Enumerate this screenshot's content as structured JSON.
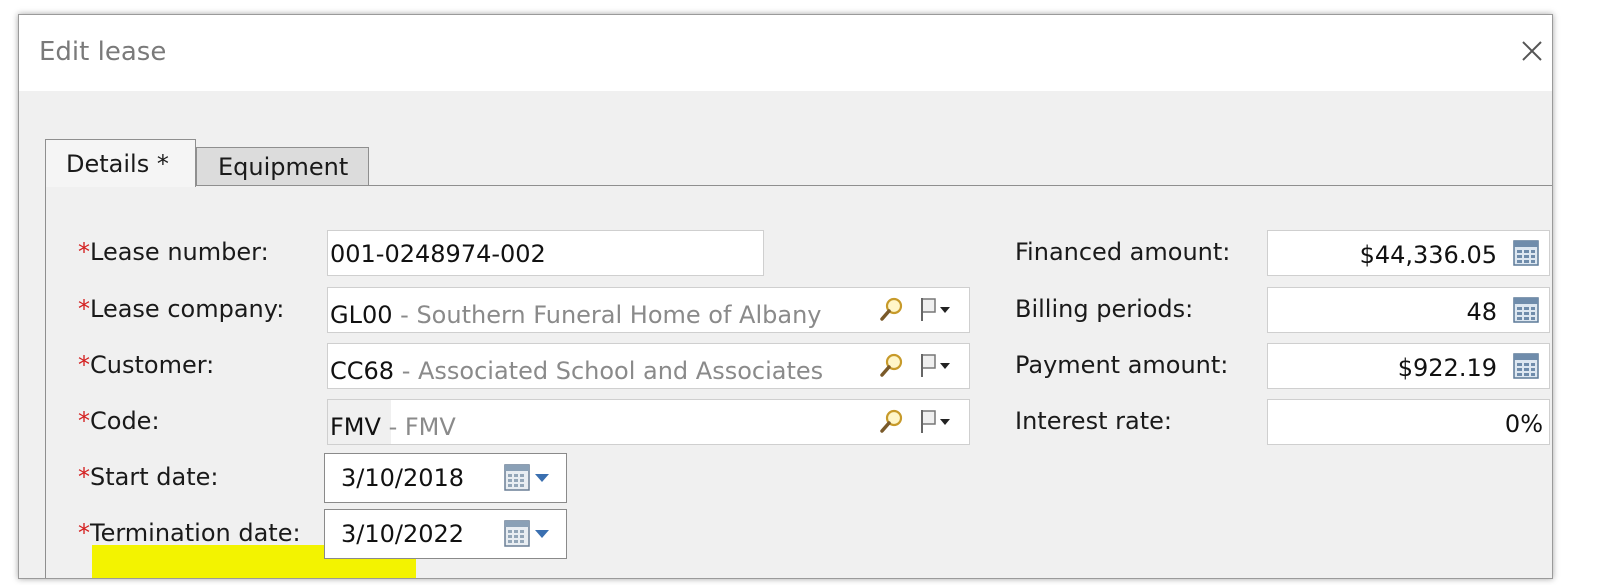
{
  "dialog": {
    "title": "Edit lease"
  },
  "tabs": [
    {
      "label": "Details *",
      "active": true
    },
    {
      "label": "Equipment",
      "active": false
    }
  ],
  "required_marker": "*",
  "left_fields": {
    "lease_number": {
      "label": "Lease number:",
      "value": "001-0248974-002"
    },
    "lease_company": {
      "label": "Lease company:",
      "code": "GL00",
      "separator": " - ",
      "description": "Southern Funeral Home of Albany"
    },
    "customer": {
      "label": "Customer:",
      "code": "CC68",
      "separator": " - ",
      "description": "Associated School and Associates"
    },
    "code": {
      "label": "Code:",
      "code": "FMV",
      "separator": " - ",
      "description": "FMV"
    },
    "start_date": {
      "label": "Start date:",
      "value": "3/10/2018"
    },
    "termination_date": {
      "label": "Termination date:",
      "value": "3/10/2022"
    }
  },
  "right_fields": {
    "financed_amount": {
      "label": "Financed amount:",
      "value": "$44,336.05"
    },
    "billing_periods": {
      "label": "Billing periods:",
      "value": "48"
    },
    "payment_amount": {
      "label": "Payment amount:",
      "value": "$922.19"
    },
    "interest_rate": {
      "label": "Interest rate:",
      "value": "0%"
    }
  },
  "colors": {
    "required": "#d42020",
    "highlight": "#f3f300",
    "description_text": "#8a8a8a"
  },
  "icons": [
    "close-icon",
    "magnifier-icon",
    "flag-dropdown-icon",
    "calendar-icon",
    "calculator-icon"
  ]
}
